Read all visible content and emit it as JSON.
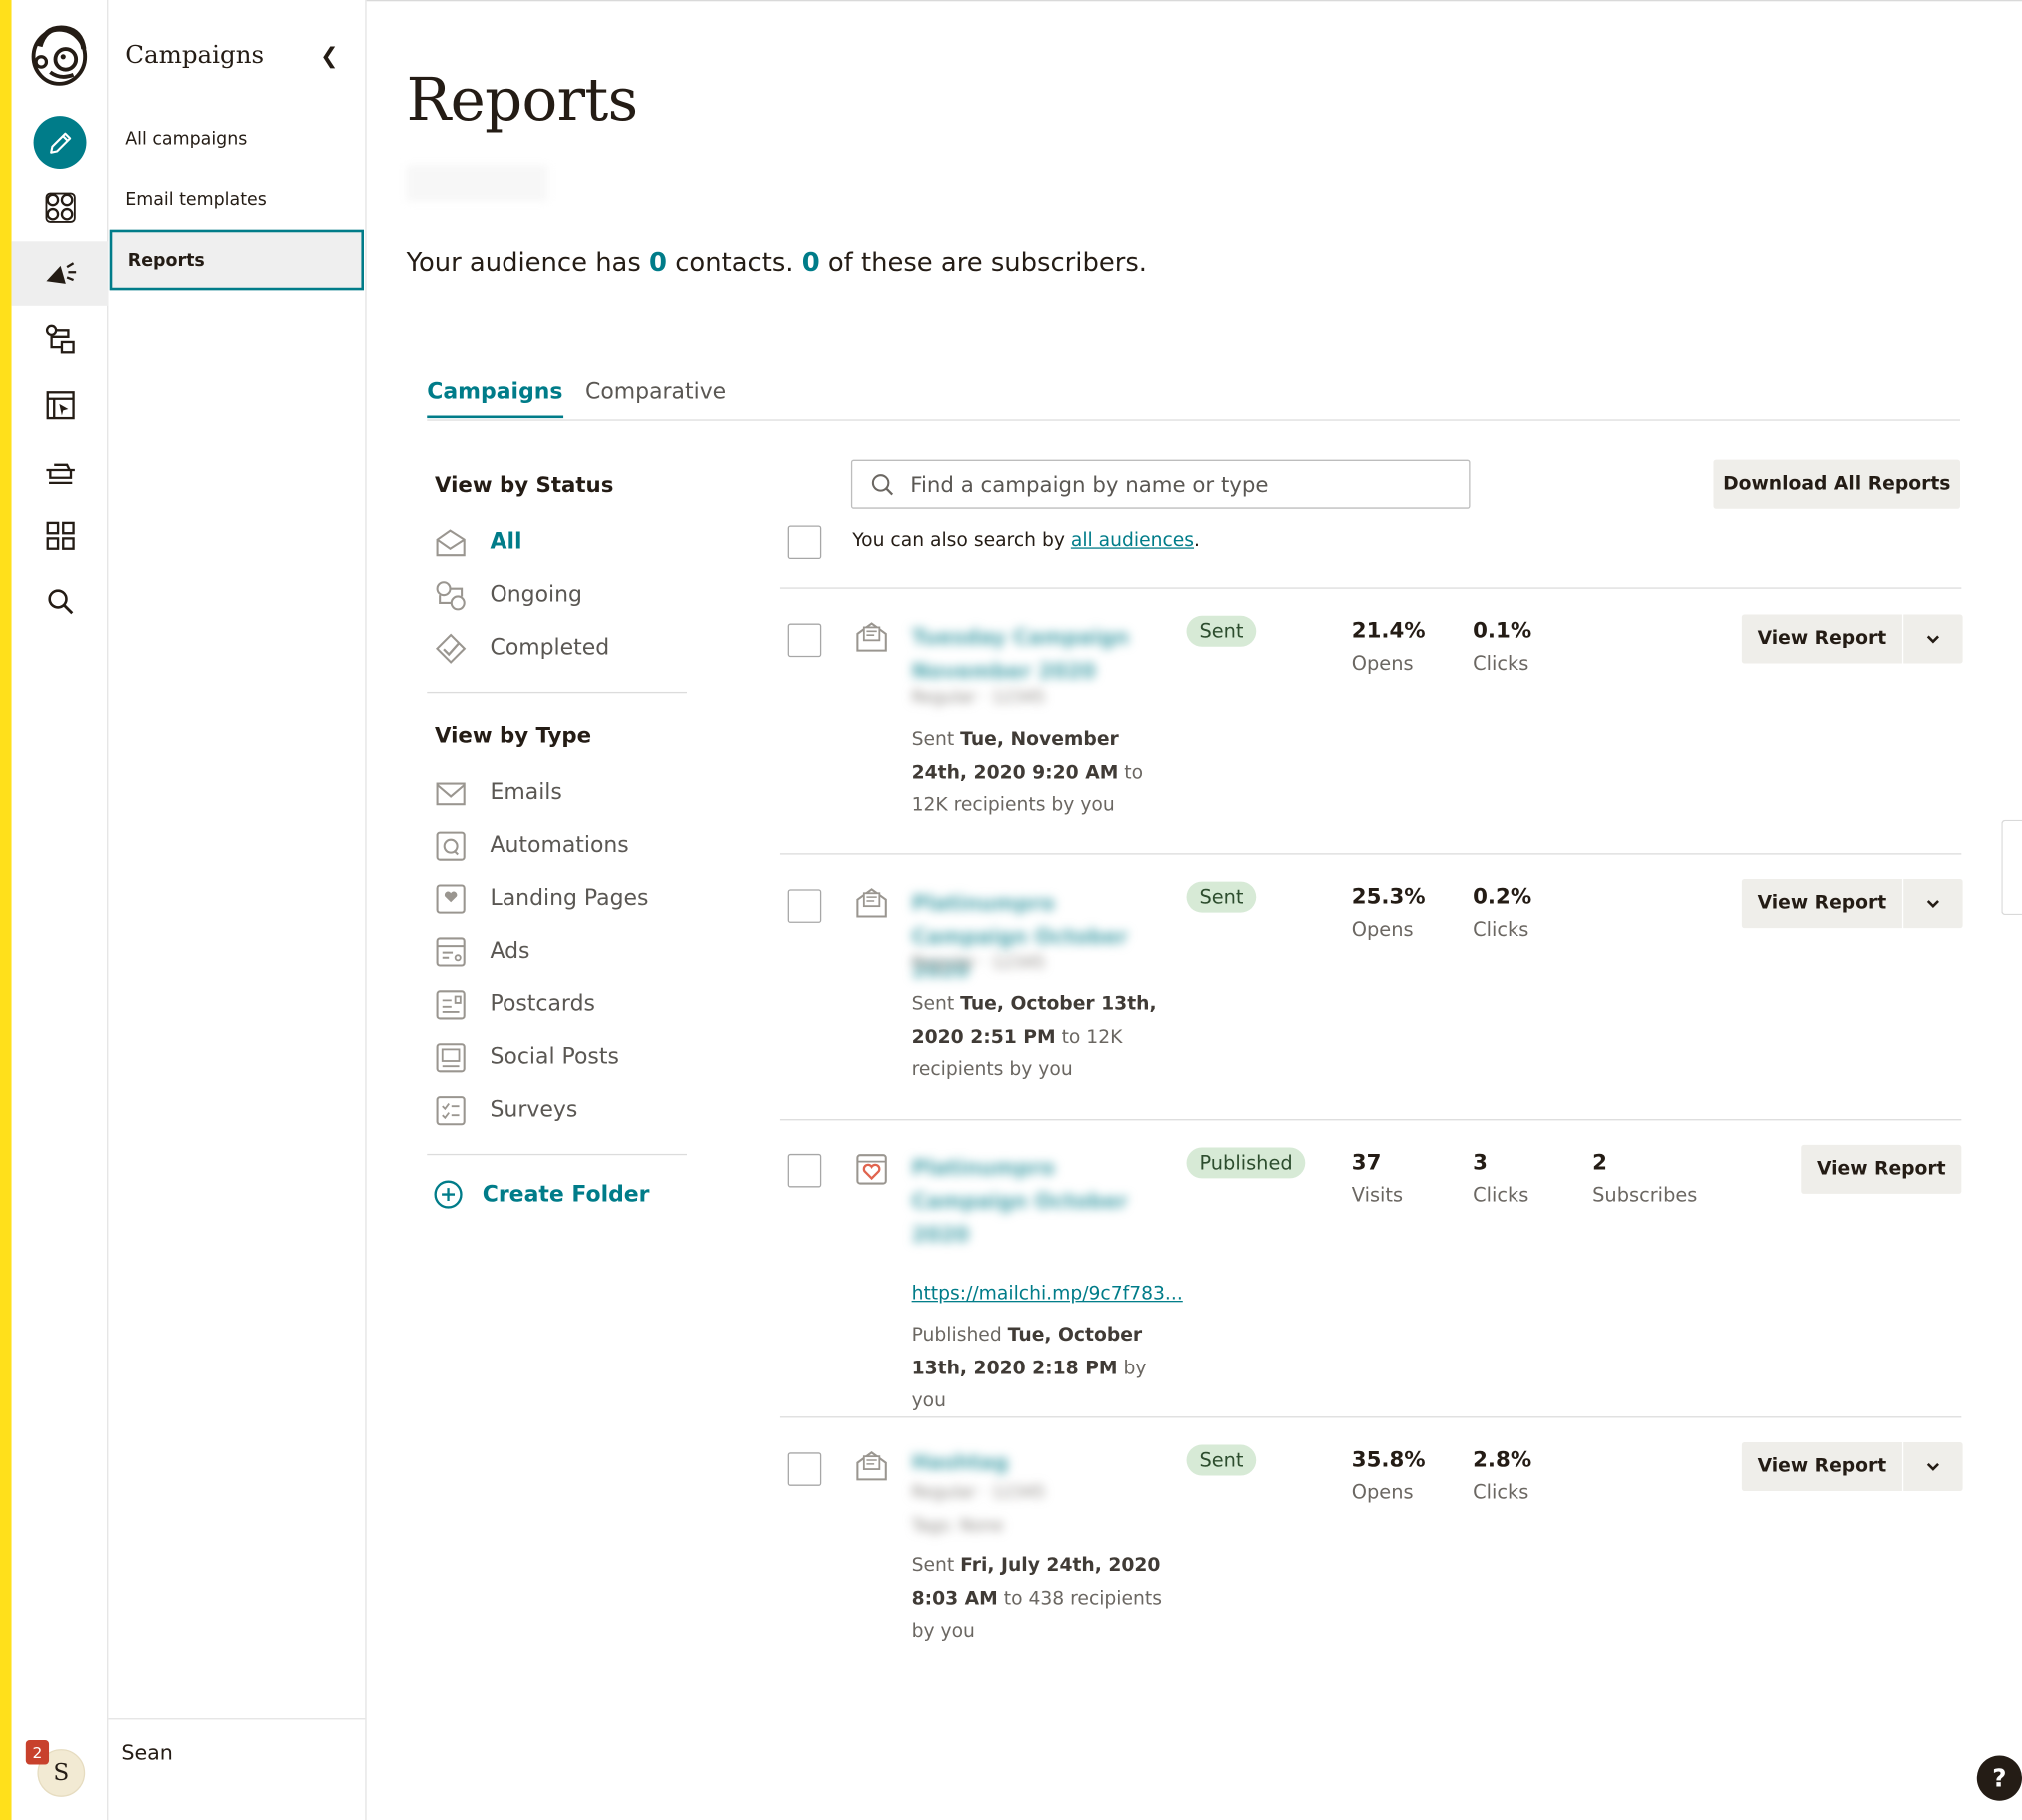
{
  "app": {
    "section_title": "Campaigns",
    "nav": [
      "All campaigns",
      "Email templates",
      "Reports"
    ],
    "user": {
      "name": "Sean",
      "initial": "S",
      "notifications": "2"
    }
  },
  "page": {
    "title": "Reports",
    "audience": {
      "prefix": "Your audience has ",
      "contacts": "0",
      "middle": " contacts. ",
      "subscribers": "0",
      "suffix": " of these are subscribers."
    }
  },
  "tabs": [
    "Campaigns",
    "Comparative"
  ],
  "filters": {
    "status_heading": "View by Status",
    "status": [
      "All",
      "Ongoing",
      "Completed"
    ],
    "type_heading": "View by Type",
    "types": [
      "Emails",
      "Automations",
      "Landing Pages",
      "Ads",
      "Postcards",
      "Social Posts",
      "Surveys"
    ],
    "create_folder": "Create Folder"
  },
  "search": {
    "placeholder": "Find a campaign by name or type",
    "also_prefix": "You can also search by ",
    "also_link": "all audiences",
    "also_suffix": "."
  },
  "download_label": "Download All Reports",
  "view_report_label": "View Report",
  "campaigns": [
    {
      "status": "Sent",
      "stat1_value": "21.4%",
      "stat1_label": "Opens",
      "stat2_value": "0.1%",
      "stat2_label": "Clicks",
      "meta_prefix": "Sent ",
      "meta_bold": "Tue, November 24th, 2020 9:20 AM",
      "meta_suffix": " to 12K recipients by you"
    },
    {
      "status": "Sent",
      "stat1_value": "25.3%",
      "stat1_label": "Opens",
      "stat2_value": "0.2%",
      "stat2_label": "Clicks",
      "meta_prefix": "Sent ",
      "meta_bold": "Tue, October 13th, 2020 2:51 PM",
      "meta_suffix": " to 12K recipients by you"
    },
    {
      "status": "Published",
      "stat1_value": "37",
      "stat1_label": "Visits",
      "stat2_value": "3",
      "stat2_label": "Clicks",
      "stat3_value": "2",
      "stat3_label": "Subscribes",
      "url": "https://mailchi.mp/9c7f783...",
      "meta_prefix": "Published ",
      "meta_bold": "Tue, October 13th, 2020 2:18 PM",
      "meta_suffix": " by you"
    },
    {
      "status": "Sent",
      "stat1_value": "35.8%",
      "stat1_label": "Opens",
      "stat2_value": "2.8%",
      "stat2_label": "Clicks",
      "meta_prefix": "Sent ",
      "meta_bold": "Fri, July 24th, 2020 8:03 AM",
      "meta_suffix": " to 438 recipients by you"
    }
  ],
  "help_label": "?",
  "colors": {
    "accent": "#007c89",
    "brand_yellow": "#ffe01b",
    "badge_bg": "#d7ead6",
    "button_bg": "#efeeea"
  }
}
